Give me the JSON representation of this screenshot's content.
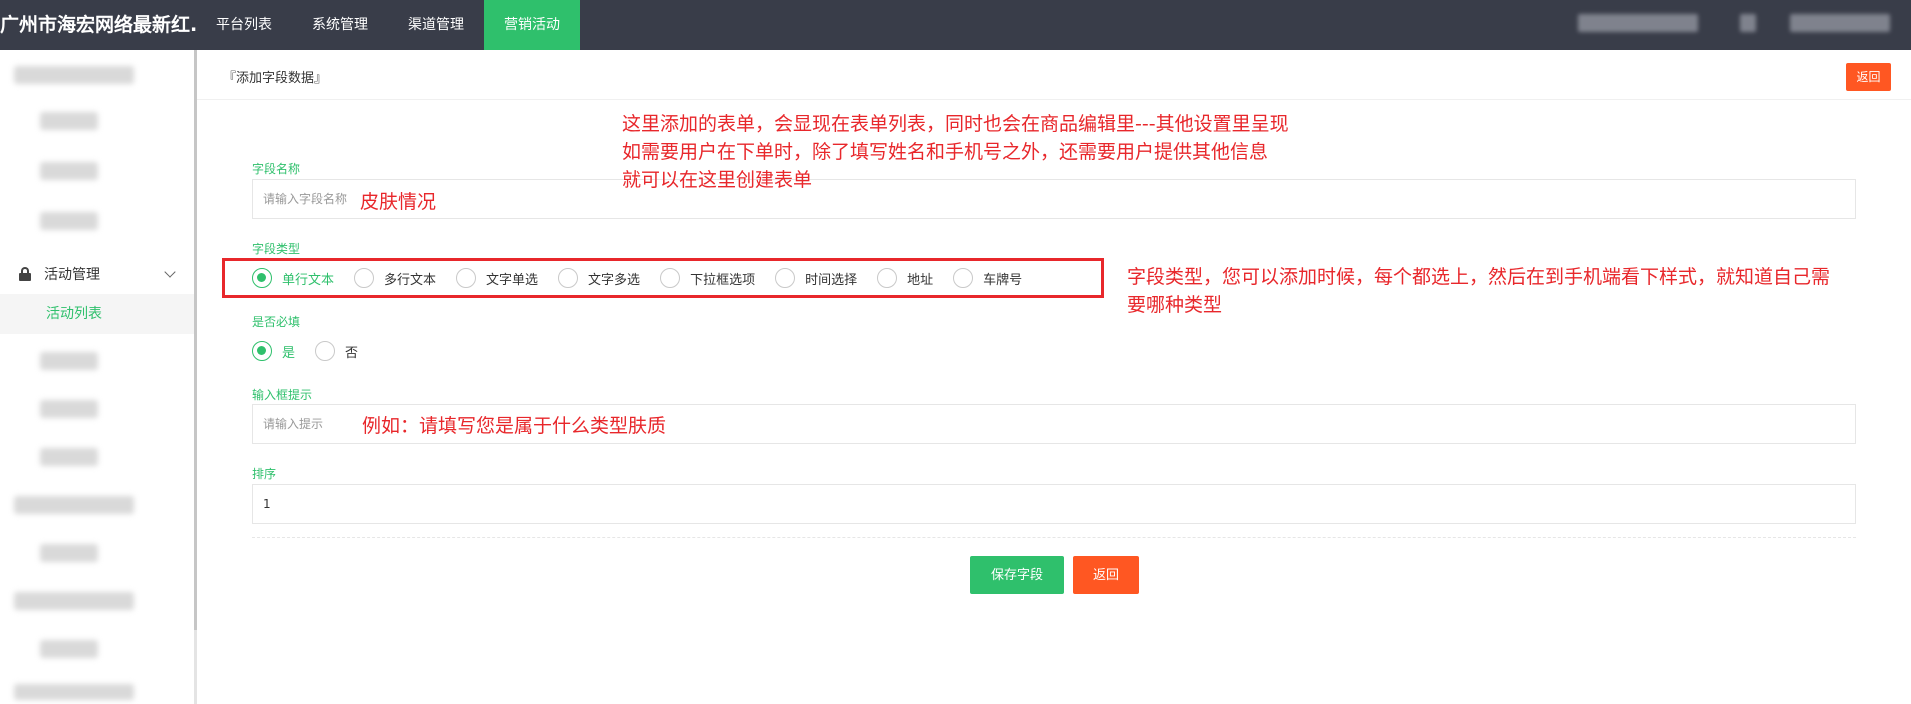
{
  "header": {
    "brand": "广州市海宏网络最新红...",
    "nav": [
      "平台列表",
      "系统管理",
      "渠道管理",
      "营销活动"
    ],
    "active_nav_index": 3
  },
  "sidebar": {
    "group_label": "活动管理",
    "active_item": "活动列表"
  },
  "page": {
    "title": "『添加字段数据』",
    "back_top_label": "返回"
  },
  "form": {
    "field_name": {
      "label": "字段名称",
      "placeholder": "请输入字段名称"
    },
    "field_type": {
      "label": "字段类型",
      "options": [
        "单行文本",
        "多行文本",
        "文字单选",
        "文字多选",
        "下拉框选项",
        "时间选择",
        "地址",
        "车牌号"
      ],
      "selected_index": 0
    },
    "required": {
      "label": "是否必填",
      "options": [
        "是",
        "否"
      ],
      "selected_index": 0
    },
    "hint": {
      "label": "输入框提示",
      "placeholder": "请输入提示"
    },
    "sort": {
      "label": "排序",
      "value": "1"
    },
    "save_label": "保存字段",
    "back_label": "返回"
  },
  "annotations": {
    "top_note": [
      "这里添加的表单，会显现在表单列表，同时也会在商品编辑里---其他设置里呈现",
      "如需要用户在下单时，除了填写姓名和手机号之外，还需要用户提供其他信息",
      "就可以在这里创建表单"
    ],
    "name_example": "皮肤情况",
    "type_note": [
      "字段类型，您可以添加时候，每个都选上，然后在到手机端看下样式，就知道自己需",
      "要哪种类型"
    ],
    "hint_example": "例如：请填写您是属于什么类型肤质"
  },
  "colors": {
    "accent": "#2fc06c",
    "danger": "#ff5722",
    "annotation": "#e8272b",
    "topbar": "#393d49"
  }
}
